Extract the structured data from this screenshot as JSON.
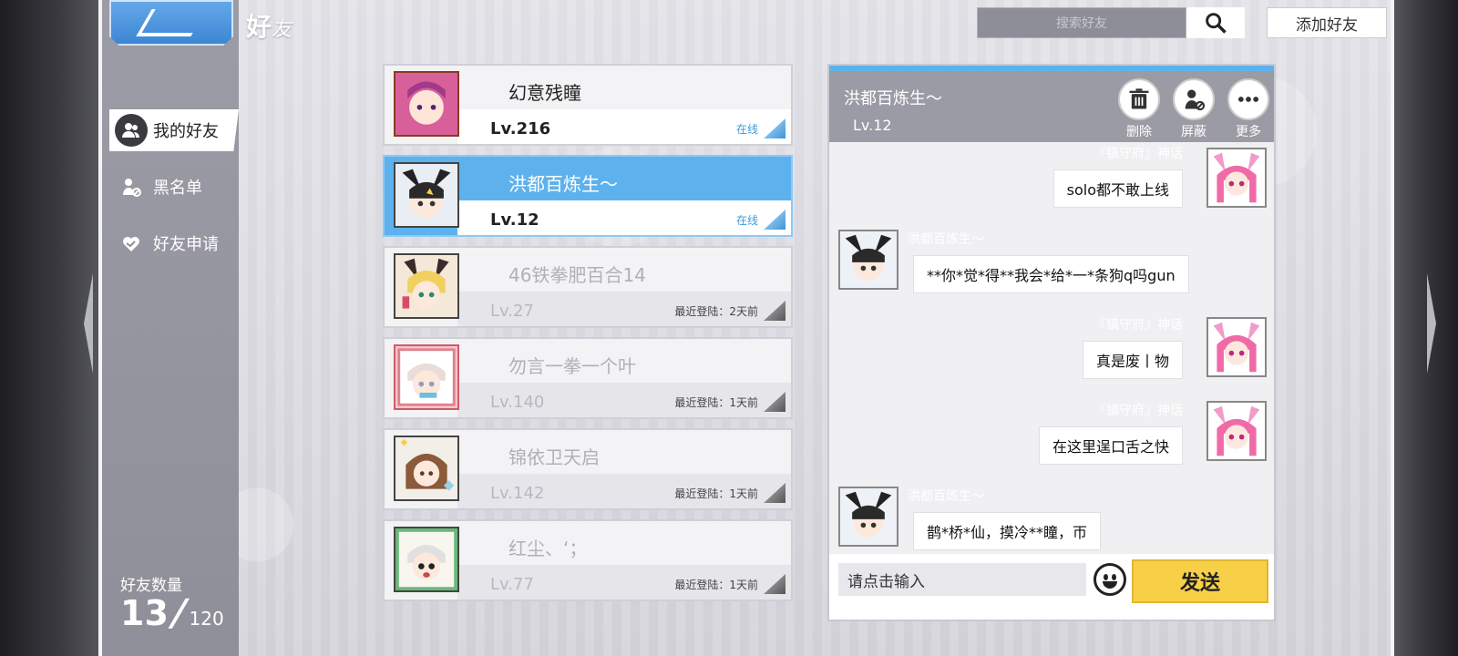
{
  "header": {
    "title": "好",
    "title_sub": "友"
  },
  "search": {
    "placeholder": "搜索好友",
    "add_friend_label": "添加好友"
  },
  "sidebar": {
    "items": [
      {
        "label": "我的好友",
        "icon": "friends-icon",
        "active": true
      },
      {
        "label": "黑名单",
        "icon": "block-user-icon",
        "active": false
      },
      {
        "label": "好友申请",
        "icon": "handshake-heart-icon",
        "active": false
      }
    ],
    "count_label": "好友数量",
    "count_current": "13",
    "count_max": "120"
  },
  "friends": [
    {
      "name": "幻意残瞳",
      "level": "Lv.216",
      "status": "在线",
      "state": "online"
    },
    {
      "name": "洪都百炼生～",
      "level": "Lv.12",
      "status": "在线",
      "state": "selected"
    },
    {
      "name": "46铁拳肥百合14",
      "level": "Lv.27",
      "status": "最近登陆：2天前",
      "state": "offline"
    },
    {
      "name": "勿言一拳一个叶",
      "level": "Lv.140",
      "status": "最近登陆：1天前",
      "state": "offline"
    },
    {
      "name": "锦依卫天启",
      "level": "Lv.142",
      "status": "最近登陆：1天前",
      "state": "offline"
    },
    {
      "name": "红尘、‘；",
      "level": "Lv.77",
      "status": "最近登陆：1天前",
      "state": "offline"
    }
  ],
  "chat": {
    "partner_name": "洪都百炼生～",
    "partner_level": "Lv.12",
    "actions": [
      {
        "label": "删除",
        "icon": "trash-icon"
      },
      {
        "label": "屏蔽",
        "icon": "block-user-icon"
      },
      {
        "label": "更多",
        "icon": "more-dots-icon"
      }
    ],
    "messages": [
      {
        "side": "right",
        "sender": "『镇守府』神话",
        "text": "solo都不敢上线"
      },
      {
        "side": "left",
        "sender": "洪都百炼生～",
        "text": "**你*觉*得**我会*给*一*条狗q吗gun"
      },
      {
        "side": "right",
        "sender": "『镇守府』神话",
        "text": "真是废丨物"
      },
      {
        "side": "right",
        "sender": "『镇守府』神话",
        "text": "在这里逞口舌之快"
      },
      {
        "side": "left",
        "sender": "洪都百炼生～",
        "text": "鹊*桥*仙，摸冷**瞳，帀"
      }
    ],
    "input_value": "请点击输入",
    "send_label": "发送"
  },
  "colors": {
    "accent_blue": "#5db2ee",
    "send_yellow": "#f8d048",
    "online_text": "#3d9ad9"
  }
}
